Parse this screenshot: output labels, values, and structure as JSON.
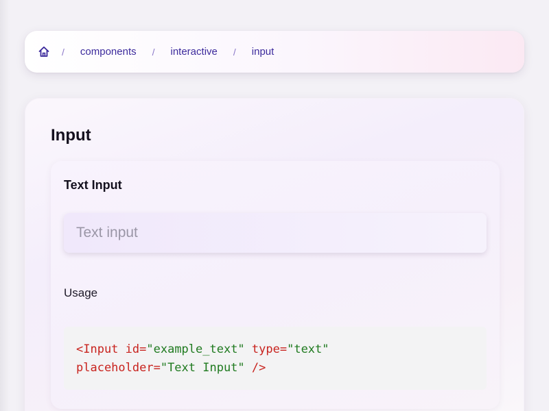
{
  "breadcrumb": {
    "home_icon": "home-icon",
    "separator": "/",
    "items": [
      "components",
      "interactive",
      "input"
    ]
  },
  "page": {
    "title": "Input"
  },
  "section": {
    "title": "Text Input",
    "input_placeholder": "Text input",
    "input_value": "",
    "usage_label": "Usage"
  },
  "code": {
    "line1_tag": "<Input",
    "line1_attr1": " id=",
    "line1_val1": "\"example_text\"",
    "line1_attr2": " type=",
    "line1_val2": "\"text\"",
    "line2_attr": "placeholder=",
    "line2_val": "\"Text Input\"",
    "line2_close": " />"
  },
  "colors": {
    "link": "#3c2a9c",
    "code_tag": "#c8231e",
    "code_string": "#1f7a1f"
  }
}
